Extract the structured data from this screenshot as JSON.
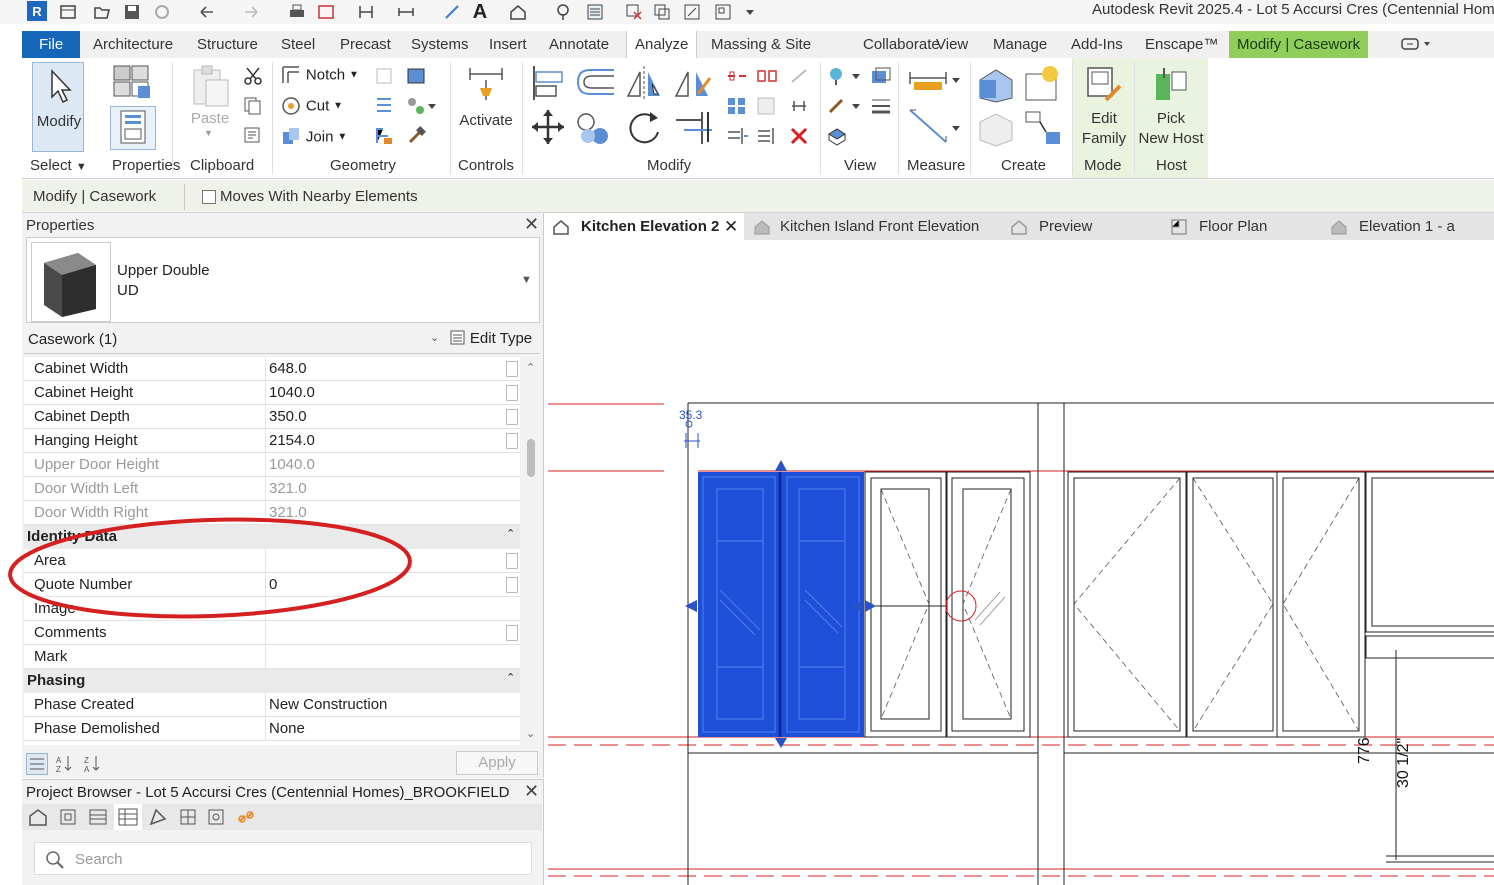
{
  "title_bar": {
    "app_logo": "R",
    "title": "Autodesk Revit 2025.4 - Lot 5 Accursi Cres (Centennial Home"
  },
  "ribbon_tabs": [
    "File",
    "Architecture",
    "Structure",
    "Steel",
    "Precast",
    "Systems",
    "Insert",
    "Annotate",
    "Analyze",
    "Massing & Site",
    "Collaborate",
    "View",
    "Manage",
    "Add-Ins",
    "Enscape™",
    "Modify | Casework"
  ],
  "ribbon": {
    "modify": "Modify",
    "paste": "Paste",
    "notch": "Notch",
    "cut": "Cut",
    "join": "Join",
    "activate": "Activate",
    "edit_family": [
      "Edit",
      "Family"
    ],
    "pick_new_host": [
      "Pick",
      "New Host"
    ],
    "panels": {
      "select": "Select",
      "properties": "Properties",
      "clipboard": "Clipboard",
      "geometry": "Geometry",
      "controls": "Controls",
      "modify": "Modify",
      "view": "View",
      "measure": "Measure",
      "create": "Create",
      "mode": "Mode",
      "host": "Host"
    }
  },
  "context_bar": {
    "label": "Modify | Casework",
    "checkbox_label": "Moves With Nearby Elements",
    "checked": false
  },
  "properties": {
    "title": "Properties",
    "type_name_line1": "Upper Double",
    "type_name_line2": "UD",
    "instance_filter": "Casework (1)",
    "edit_type": "Edit Type",
    "rows_top": [
      {
        "name": "Cabinet Width",
        "value": "648.0",
        "grey": false
      },
      {
        "name": "Cabinet Height",
        "value": "1040.0",
        "grey": false
      },
      {
        "name": "Cabinet Depth",
        "value": "350.0",
        "grey": false
      },
      {
        "name": "Hanging Height",
        "value": "2154.0",
        "grey": false
      },
      {
        "name": "Upper Door Height",
        "value": "1040.0",
        "grey": true
      },
      {
        "name": "Door Width Left",
        "value": "321.0",
        "grey": true
      },
      {
        "name": "Door Width Right",
        "value": "321.0",
        "grey": true
      }
    ],
    "group_identity": "Identity Data",
    "rows_identity": [
      {
        "name": "Area",
        "value": ""
      },
      {
        "name": "Quote Number",
        "value": "0"
      },
      {
        "name": "Image",
        "value": ""
      },
      {
        "name": "Comments",
        "value": ""
      },
      {
        "name": "Mark",
        "value": ""
      }
    ],
    "group_phasing": "Phasing",
    "rows_phasing": [
      {
        "name": "Phase Created",
        "value": "New Construction"
      },
      {
        "name": "Phase Demolished",
        "value": "None"
      }
    ],
    "apply": "Apply",
    "annotation_color": "#d42020"
  },
  "project_browser": {
    "title": "Project Browser - Lot 5 Accursi Cres (Centennial Homes)_BROOKFIELD",
    "search_placeholder": "Search"
  },
  "view_tabs": [
    "Kitchen Elevation 2",
    "Kitchen Island Front Elevation",
    "Preview",
    "Floor Plan",
    "Elevation 1 - a"
  ],
  "canvas": {
    "dim_top": "35.3",
    "dim_776": "776",
    "dim_imperial": "30 1/2\"",
    "selection_color": "#1f4fd8"
  }
}
